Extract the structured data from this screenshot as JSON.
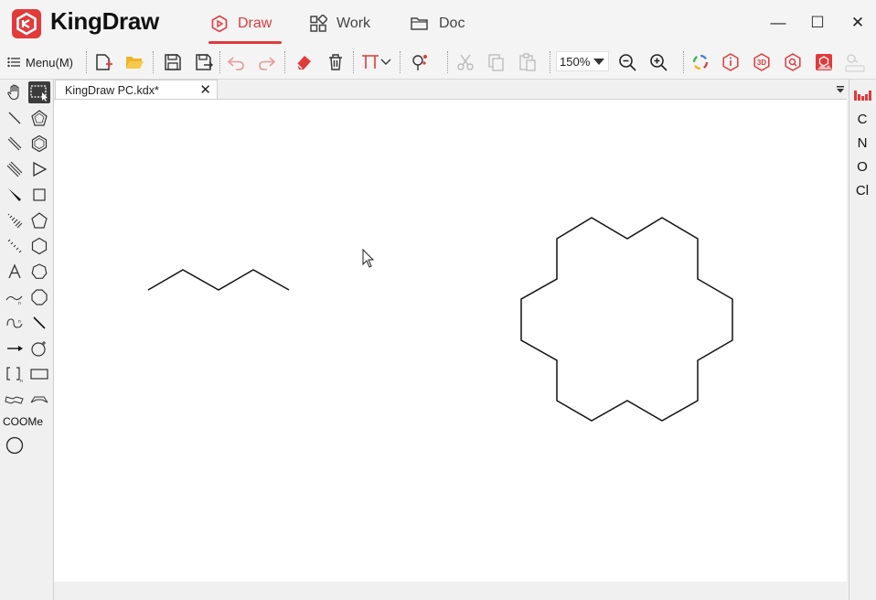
{
  "app": {
    "name": "KingDraw",
    "brand_color": "#e23a3a"
  },
  "nav_tabs": [
    {
      "label": "Draw",
      "icon": "draw-icon",
      "active": true
    },
    {
      "label": "Work",
      "icon": "grid-icon",
      "active": false
    },
    {
      "label": "Doc",
      "icon": "folder-icon",
      "active": false
    }
  ],
  "window_controls": {
    "minimize": "—",
    "maximize": "☐",
    "close": "✕"
  },
  "toolbar": {
    "menu_label": "Menu(M)",
    "zoom_value": "150%",
    "icons": [
      "new-file-icon",
      "open-folder-icon",
      "save-icon",
      "save-as-icon",
      "undo-icon",
      "redo-icon",
      "eraser-icon",
      "delete-icon",
      "text-align-icon",
      "dropdown-arrow-icon",
      "structure-check-icon",
      "cut-icon",
      "copy-icon",
      "paste-icon",
      "zoom-out-icon",
      "zoom-in-icon",
      "color-ring-icon",
      "info-icon",
      "3d-view-icon",
      "search-structure-icon",
      "image-recognition-icon",
      "name-icon"
    ]
  },
  "document_tab": {
    "title": "KingDraw PC.kdx*",
    "close": "✕"
  },
  "left_tools": {
    "coome_label": "COOMe",
    "icons": [
      "hand-icon",
      "rectangle-select-icon",
      "single-bond-icon",
      "pentagon-icon",
      "double-bond-icon",
      "benzene-icon",
      "triple-bond-icon",
      "triangle-icon",
      "wedge-bond-icon",
      "square-icon",
      "hash-wedge-bond-icon",
      "pentagon-ring-icon",
      "hash-bond-icon",
      "hexagon-ring-icon",
      "text-icon",
      "heptagon-ring-icon",
      "wavy-bond-icon",
      "octagon-ring-icon",
      "curve-icon",
      "line-icon",
      "arrow-icon",
      "rotate-icon",
      "bracket-icon",
      "rectangle-icon",
      "chair-icon",
      "boat-icon",
      "circle-icon"
    ]
  },
  "right_elements": [
    "C",
    "N",
    "O",
    "Cl"
  ],
  "right_panel_icon": "periodic-table-icon",
  "canvas": {
    "molecules": [
      "pentane-chain",
      "coronene-like-ring"
    ]
  }
}
